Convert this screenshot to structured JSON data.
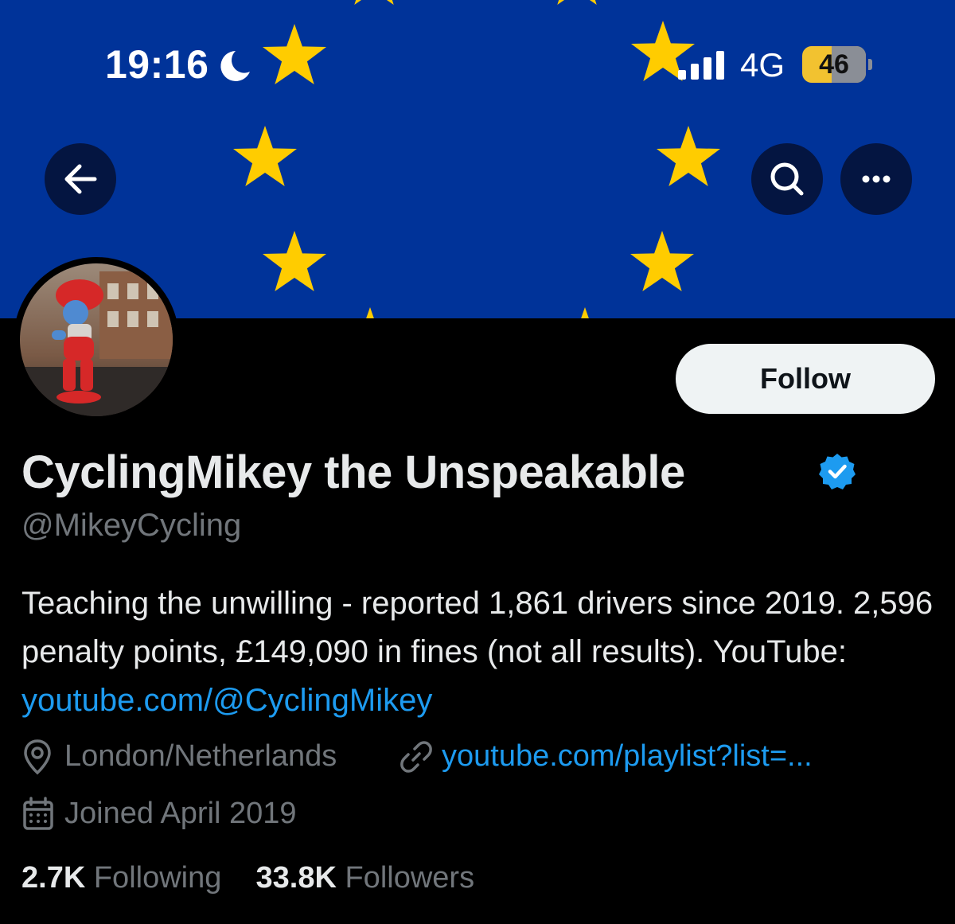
{
  "status_bar": {
    "time": "19:16",
    "network": "4G",
    "battery": "46",
    "battery_percent": 46
  },
  "header": {
    "banner_color": "#003399",
    "star_color": "#FFCC00"
  },
  "profile": {
    "follow_label": "Follow",
    "display_name": "CyclingMikey the Unspeakable",
    "handle": "@MikeyCycling",
    "bio": {
      "text": "Teaching the unwilling - reported 1,861 drivers since 2019. 2,596 penalty points, £149,090 in fines (not all results). YouTube: ",
      "link": "youtube.com/@CyclingMikey"
    },
    "location": "London/Netherlands",
    "website": "youtube.com/playlist?list=...",
    "joined": "Joined April 2019",
    "following_count": "2.7K",
    "following_label": "Following",
    "followers_count": "33.8K",
    "followers_label": "Followers"
  },
  "colors": {
    "background": "#000000",
    "link": "#1d9bf0",
    "muted": "#71767b",
    "text": "#e7e9ea",
    "verified": "#1d9bf0"
  },
  "icons": {
    "back": "arrow-left-icon",
    "search": "search-icon",
    "more": "more-horizontal-icon",
    "verified": "verified-badge-icon",
    "location": "location-pin-icon",
    "link": "link-icon",
    "calendar": "calendar-icon"
  }
}
